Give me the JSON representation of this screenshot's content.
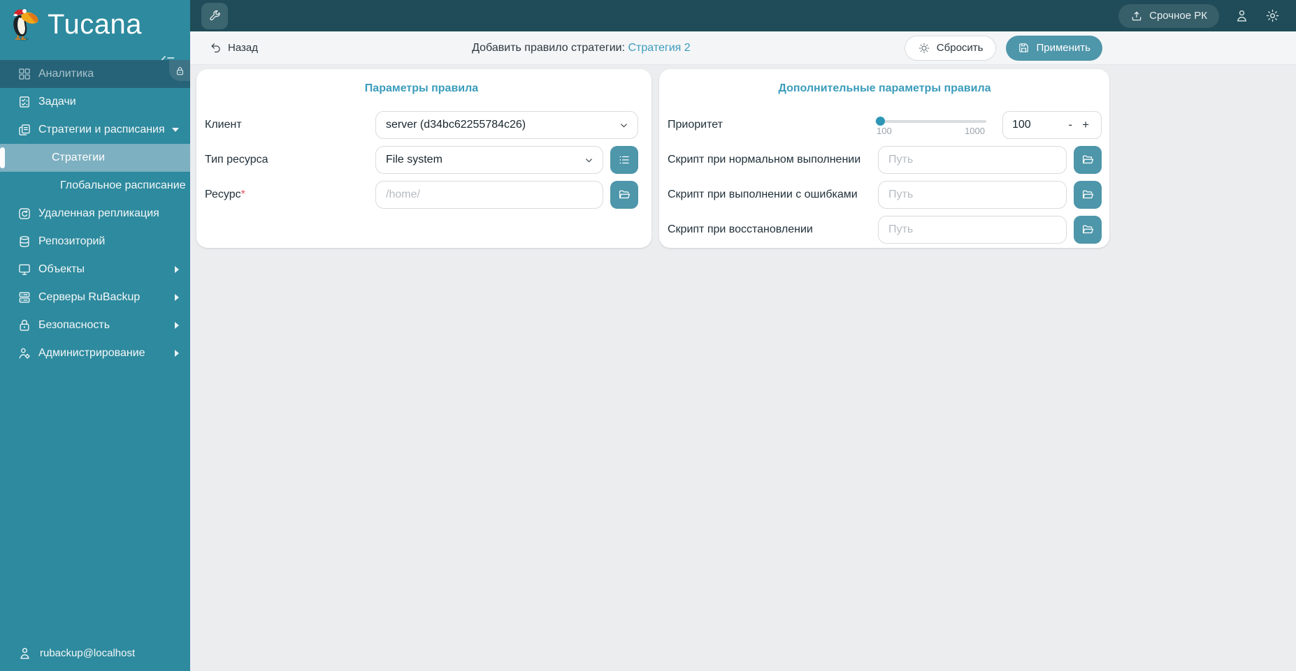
{
  "app": {
    "logo_text": "Tucana"
  },
  "colors": {
    "sidebar": "#2e8a9e",
    "sidebar_selected": "#7db0c1",
    "sidebar_disabled_row": "#266378",
    "topbar": "#1f4c58",
    "accent_text": "#3b9cbb",
    "button_teal": "#4e96aa",
    "required_asterisk": "#e25563",
    "content_bg": "#ecedef"
  },
  "sidebar": {
    "items": [
      {
        "label": "Аналитика",
        "icon": "grid",
        "state": "disabled",
        "locked": true
      },
      {
        "label": "Задачи",
        "icon": "tasks"
      },
      {
        "label": "Стратегии и расписания",
        "icon": "strategies",
        "expanded": true,
        "children": [
          {
            "label": "Стратегии",
            "selected": true
          },
          {
            "label": "Глобальное расписание"
          }
        ]
      },
      {
        "label": "Удаленная репликация",
        "icon": "replication"
      },
      {
        "label": "Репозиторий",
        "icon": "repository"
      },
      {
        "label": "Объекты",
        "icon": "objects",
        "has_children": true
      },
      {
        "label": "Серверы RuBackup",
        "icon": "servers",
        "has_children": true
      },
      {
        "label": "Безопасность",
        "icon": "security",
        "has_children": true
      },
      {
        "label": "Администрирование",
        "icon": "administration",
        "has_children": true
      }
    ],
    "footer": {
      "user": "rubackup@localhost"
    }
  },
  "topbar": {
    "urgent_backup_label": "Срочное РК"
  },
  "header": {
    "back_label": "Назад",
    "title": "Добавить правило стратегии:",
    "title_link": "Стратегия 2",
    "reset_label": "Сбросить",
    "apply_label": "Применить"
  },
  "rule_params": {
    "title": "Параметры правила",
    "client_label": "Клиент",
    "client_value": "server (d34bc62255784c26)",
    "resource_type_label": "Тип ресурса",
    "resource_type_value": "File system",
    "resource_label": "Ресурс",
    "resource_required_mark": "*",
    "resource_placeholder": "/home/"
  },
  "extra_params": {
    "title": "Дополнительные параметры правила",
    "priority_label": "Приоритет",
    "priority_min": "100",
    "priority_max": "1000",
    "priority_value": "100",
    "minus_label": "-",
    "plus_label": "+",
    "scripts": [
      {
        "label": "Скрипт при нормальном выполнении",
        "placeholder": "Путь"
      },
      {
        "label": "Скрипт при выполнении с ошибками",
        "placeholder": "Путь"
      },
      {
        "label": "Скрипт при восстановлении",
        "placeholder": "Путь"
      }
    ]
  }
}
